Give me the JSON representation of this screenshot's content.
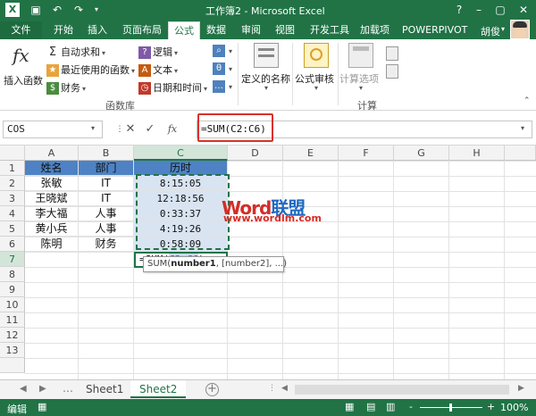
{
  "window": {
    "title": "工作簿2 - Microsoft Excel",
    "help": "?",
    "minimize": "–",
    "restore": "▢",
    "close": "✕"
  },
  "quick_access": {
    "undo": "↶",
    "redo": "↷",
    "save": "▣"
  },
  "tabs": [
    "文件",
    "开始",
    "插入",
    "页面布局",
    "公式",
    "数据",
    "审阅",
    "视图",
    "开发工具",
    "加载项",
    "POWERPIVOT"
  ],
  "active_tab": "公式",
  "user": {
    "name": "胡俊"
  },
  "ribbon": {
    "function_library": {
      "label": "函数库",
      "insert_function": "插入函数",
      "autosum": "自动求和",
      "recent": "最近使用的函数",
      "financial": "财务",
      "logical": "逻辑",
      "text": "文本",
      "datetime": "日期和时间"
    },
    "defined_names": {
      "label": "定义的名称"
    },
    "formula_auditing": {
      "label": "公式审核"
    },
    "calculation": {
      "label": "计算",
      "options": "计算选项"
    }
  },
  "formula_bar": {
    "name_box": "COS",
    "cancel": "✕",
    "enter": "✓",
    "fx": "fx",
    "formula": "=SUM(C2:C6)"
  },
  "grid": {
    "columns": [
      "A",
      "B",
      "C",
      "D",
      "E",
      "F",
      "G",
      "H"
    ],
    "rows": [
      "1",
      "2",
      "3",
      "4",
      "5",
      "6",
      "7",
      "8",
      "9",
      "10",
      "11",
      "12",
      "13"
    ],
    "headers": [
      "姓名",
      "部门",
      "历时"
    ],
    "data": [
      [
        "张敏",
        "IT",
        "8:15:05"
      ],
      [
        "王晓斌",
        "IT",
        "12:18:56"
      ],
      [
        "李大福",
        "人事",
        "0:33:37"
      ],
      [
        "黄小兵",
        "人事",
        "4:19:26"
      ],
      [
        "陈明",
        "财务",
        "0:58:09"
      ]
    ],
    "edit_prefix": "=SUM(",
    "edit_ref": "C2:C6",
    "edit_suffix": ")",
    "tooltip_func": "SUM(",
    "tooltip_arg1": "number1",
    "tooltip_rest": ", [number2], ...)"
  },
  "watermark": {
    "word_red": "Word",
    "word_blue": "联盟",
    "url": "www.wordlm.com"
  },
  "sheets": [
    "Sheet1",
    "Sheet2"
  ],
  "active_sheet": "Sheet2",
  "status": {
    "mode": "编辑",
    "zoom": "100%",
    "zoom_minus": "-",
    "zoom_plus": "+"
  },
  "colors": {
    "accent": "#217346",
    "header_fill": "#4e82c4",
    "time_fill": "#d9e4f2",
    "highlight": "#d9312b"
  }
}
